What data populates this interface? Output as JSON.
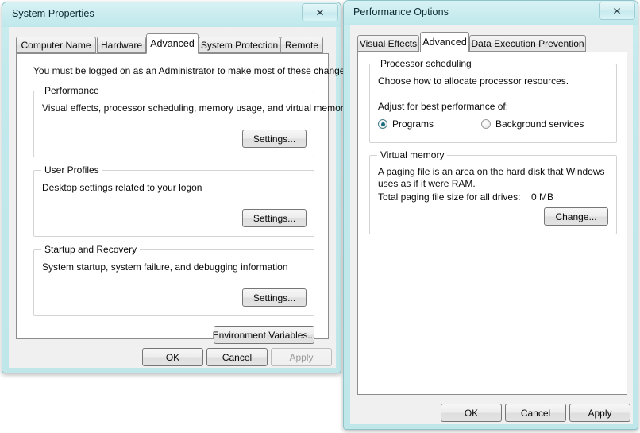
{
  "system_properties": {
    "title": "System Properties",
    "close_label": "✕",
    "tabs": [
      {
        "label": "Computer Name",
        "active": false
      },
      {
        "label": "Hardware",
        "active": false
      },
      {
        "label": "Advanced",
        "active": true
      },
      {
        "label": "System Protection",
        "active": false
      },
      {
        "label": "Remote",
        "active": false
      }
    ],
    "admin_notice": "You must be logged on as an Administrator to make most of these changes.",
    "groups": [
      {
        "title": "Performance",
        "description": "Visual effects, processor scheduling, memory usage, and virtual memory",
        "button": "Settings..."
      },
      {
        "title": "User Profiles",
        "description": "Desktop settings related to your logon",
        "button": "Settings..."
      },
      {
        "title": "Startup and Recovery",
        "description": "System startup, system failure, and debugging information",
        "button": "Settings..."
      }
    ],
    "environment_variables_button": "Environment Variables...",
    "footer": {
      "ok": "OK",
      "cancel": "Cancel",
      "apply": "Apply",
      "apply_enabled": false
    }
  },
  "performance_options": {
    "title": "Performance Options",
    "close_label": "✕",
    "tabs": [
      {
        "label": "Visual Effects",
        "active": false
      },
      {
        "label": "Advanced",
        "active": true
      },
      {
        "label": "Data Execution Prevention",
        "active": false
      }
    ],
    "processor_scheduling": {
      "title": "Processor scheduling",
      "description": "Choose how to allocate processor resources.",
      "prompt": "Adjust for best performance of:",
      "options": [
        {
          "label": "Programs",
          "selected": true
        },
        {
          "label": "Background services",
          "selected": false
        }
      ]
    },
    "virtual_memory": {
      "title": "Virtual memory",
      "description": "A paging file is an area on the hard disk that Windows uses as if it were RAM.",
      "total_label": "Total paging file size for all drives:",
      "total_value": "0 MB",
      "button": "Change..."
    },
    "footer": {
      "ok": "OK",
      "cancel": "Cancel",
      "apply": "Apply",
      "apply_enabled": true
    }
  },
  "colors": {
    "glass_border": "#bfe8ec",
    "client_bg": "#f0f0f0",
    "panel_bg": "#ffffff",
    "radio_accent": "#1a6e82"
  }
}
